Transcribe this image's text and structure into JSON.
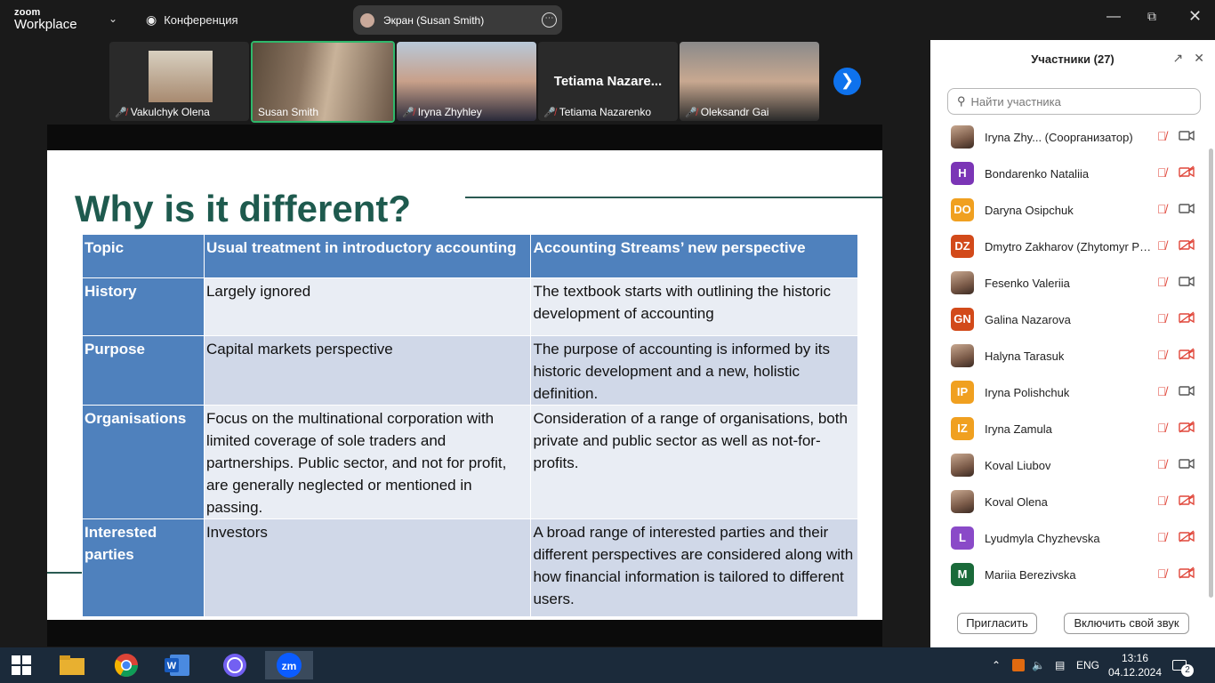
{
  "topbar": {
    "logo_top": "zoom",
    "logo_bottom": "Workplace",
    "conference": "Конференция",
    "share_label": "Экран (Susan Smith)"
  },
  "thumbnails": [
    {
      "name": "Vakulchyk Olena",
      "muted": true
    },
    {
      "name": "Susan Smith",
      "muted": false,
      "active": true
    },
    {
      "name": "Iryna Zhyhley",
      "muted": true
    },
    {
      "name": "Tetiama Nazarenko",
      "muted": true,
      "big": "Tetiama  Nazare..."
    },
    {
      "name": "Oleksandr Gai",
      "muted": true
    }
  ],
  "slide": {
    "title": "Why is it different?",
    "headers": [
      "Topic",
      "Usual treatment in introductory accounting",
      "Accounting Streams’ new perspective"
    ],
    "rows": [
      {
        "topic": "History",
        "usual": "Largely ignored",
        "new": "The textbook starts with outlining the historic development of accounting"
      },
      {
        "topic": "Purpose",
        "usual": "Capital markets perspective",
        "new": "The purpose of accounting is informed by its historic development and a new, holistic definition."
      },
      {
        "topic": "Organisations",
        "usual": "Focus on the multinational corporation with limited coverage of sole traders and partnerships. Public sector, and not for profit, are generally neglected or mentioned in passing.",
        "new": "Consideration of a range of organisations, both private and public sector as well as not-for-profits."
      },
      {
        "topic": "Interested parties",
        "usual": "Investors",
        "new": "A broad range of interested parties and their different perspectives are considered along with how financial information is tailored to different users."
      }
    ]
  },
  "panel": {
    "title": "Участники (27)",
    "search_placeholder": "Найти участника",
    "invite": "Пригласить",
    "unmute": "Включить свой звук",
    "participants": [
      {
        "name": "Iryna Zhy...  (Соорганизатор)",
        "initials": "",
        "color": "",
        "photo": true,
        "cam_off": false
      },
      {
        "name": "Bondarenko Nataliia",
        "initials": "H",
        "color": "#7b35b6",
        "photo": false,
        "cam_off": true
      },
      {
        "name": "Daryna Osipchuk",
        "initials": "DO",
        "color": "#f0a020",
        "photo": false,
        "cam_off": false
      },
      {
        "name": "Dmytro Zakharov (Zhytomyr Po...",
        "initials": "DZ",
        "color": "#d24a1a",
        "photo": false,
        "cam_off": true
      },
      {
        "name": "Fesenko Valeriia",
        "initials": "",
        "color": "",
        "photo": true,
        "cam_off": false
      },
      {
        "name": "Galina Nazarova",
        "initials": "GN",
        "color": "#d24a1a",
        "photo": false,
        "cam_off": true
      },
      {
        "name": "Halyna Tarasuk",
        "initials": "",
        "color": "",
        "photo": true,
        "cam_off": true
      },
      {
        "name": "Iryna Polishchuk",
        "initials": "IP",
        "color": "#f0a020",
        "photo": false,
        "cam_off": false
      },
      {
        "name": "Iryna Zamula",
        "initials": "IZ",
        "color": "#f0a020",
        "photo": false,
        "cam_off": true
      },
      {
        "name": "Koval Liubov",
        "initials": "",
        "color": "",
        "photo": true,
        "cam_off": false
      },
      {
        "name": "Koval Olena",
        "initials": "",
        "color": "",
        "photo": true,
        "cam_off": true
      },
      {
        "name": "Lyudmyla Chyzhevska",
        "initials": "L",
        "color": "#8a4ac8",
        "photo": false,
        "cam_off": true
      },
      {
        "name": "Mariia Berezivska",
        "initials": "M",
        "color": "#1a6a3a",
        "photo": false,
        "cam_off": true
      }
    ]
  },
  "taskbar": {
    "lang": "ENG",
    "time": "13:16",
    "date": "04.12.2024",
    "notifications": "2"
  }
}
